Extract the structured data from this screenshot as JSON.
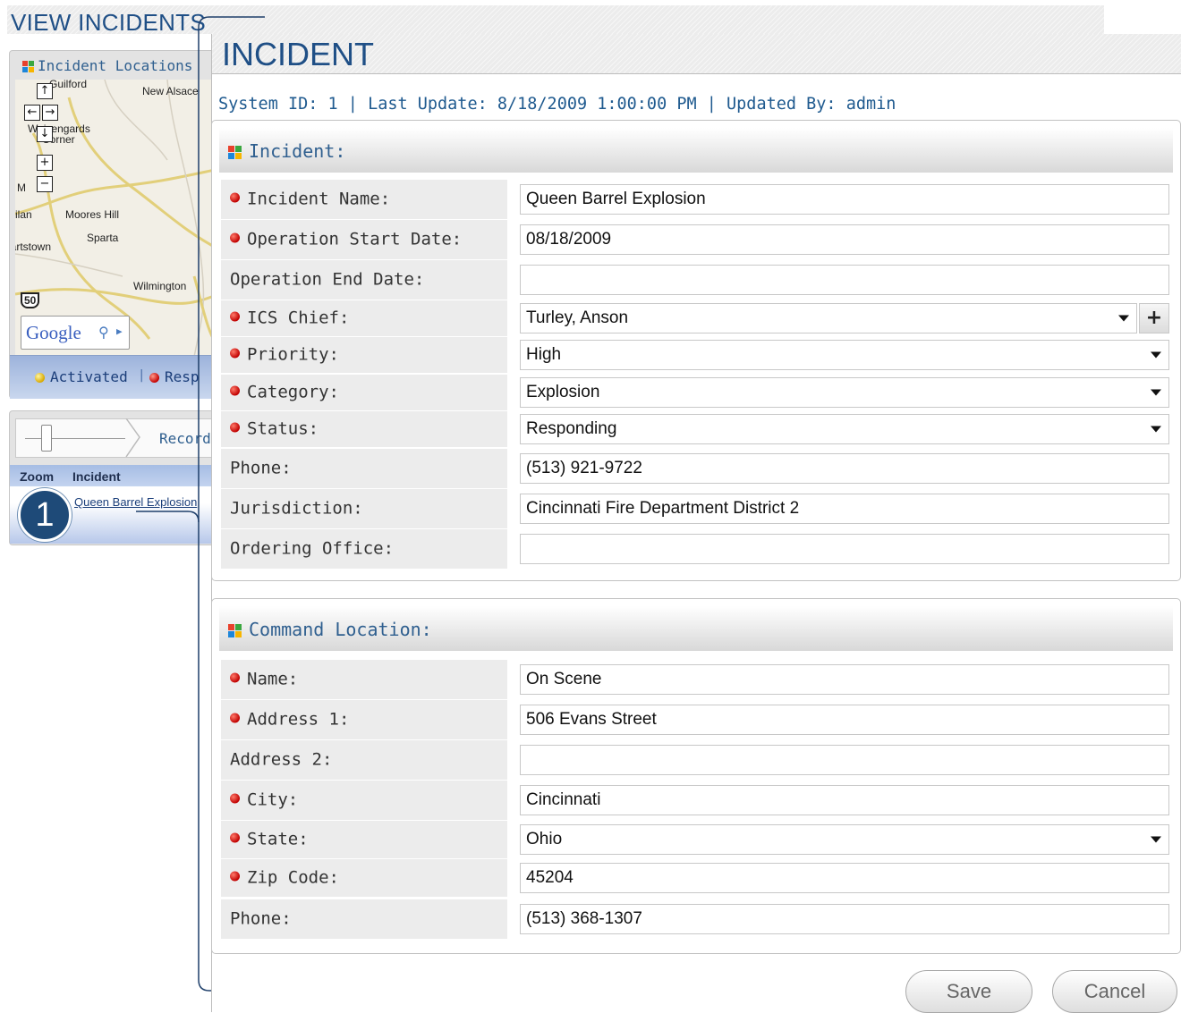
{
  "background": {
    "page_title": "VIEW INCIDENTS",
    "map_panel": {
      "title": "Incident Locations",
      "map_labels": [
        "Guilford",
        "New Alsace",
        "Weisengards",
        "Corner",
        "M",
        "Milan",
        "Moores Hill",
        "Sparta",
        "Hartstown",
        "Wilmington",
        "50"
      ],
      "controls": {
        "pan_up": "↑",
        "pan_left": "←",
        "pan_right": "→",
        "pan_down": "↓",
        "zoom_in": "+",
        "zoom_out": "−"
      },
      "google_text": "Google",
      "legend": {
        "activated": "Activated",
        "separator": "|",
        "responding": "Resp"
      }
    },
    "records_panel": {
      "label": "Record",
      "columns": [
        "Zoom",
        "Incident"
      ],
      "rows": [
        {
          "incident": "Queen Barrel Explosion"
        }
      ]
    },
    "callout_number": "1"
  },
  "modal": {
    "title": "INCIDENT",
    "meta": "System ID: 1 | Last Update: 8/18/2009 1:00:00 PM | Updated By: admin",
    "incident_section": {
      "title": "Incident:",
      "fields": [
        {
          "label": "Incident Name:",
          "required": true,
          "type": "text",
          "value": "Queen Barrel Explosion"
        },
        {
          "label": "Operation Start Date:",
          "required": true,
          "type": "text",
          "value": "08/18/2009"
        },
        {
          "label": "Operation End Date:",
          "required": false,
          "type": "text",
          "value": ""
        },
        {
          "label": "ICS Chief:",
          "required": true,
          "type": "select-add",
          "value": "Turley, Anson"
        },
        {
          "label": "Priority:",
          "required": true,
          "type": "select",
          "value": "High"
        },
        {
          "label": "Category:",
          "required": true,
          "type": "select",
          "value": "Explosion"
        },
        {
          "label": "Status:",
          "required": true,
          "type": "select",
          "value": "Responding"
        },
        {
          "label": "Phone:",
          "required": false,
          "type": "text",
          "value": "(513) 921-9722"
        },
        {
          "label": "Jurisdiction:",
          "required": false,
          "type": "text",
          "value": "Cincinnati Fire Department District 2"
        },
        {
          "label": "Ordering Office:",
          "required": false,
          "type": "text",
          "value": ""
        }
      ],
      "add_button": "+"
    },
    "command_section": {
      "title": "Command Location:",
      "fields": [
        {
          "label": "Name:",
          "required": true,
          "type": "text",
          "value": "On Scene"
        },
        {
          "label": "Address 1:",
          "required": true,
          "type": "text",
          "value": "506 Evans Street"
        },
        {
          "label": "Address 2:",
          "required": false,
          "type": "text",
          "value": ""
        },
        {
          "label": "City:",
          "required": true,
          "type": "text",
          "value": "Cincinnati"
        },
        {
          "label": "State:",
          "required": true,
          "type": "select",
          "value": "Ohio"
        },
        {
          "label": "Zip Code:",
          "required": true,
          "type": "text",
          "value": "45204"
        },
        {
          "label": "Phone:",
          "required": false,
          "type": "text",
          "value": "(513) 368-1307"
        }
      ]
    },
    "buttons": {
      "save": "Save",
      "cancel": "Cancel"
    }
  },
  "colors": {
    "title_blue": "#1f4f86",
    "required_red": "#c00000",
    "label_bg": "#ececec"
  }
}
